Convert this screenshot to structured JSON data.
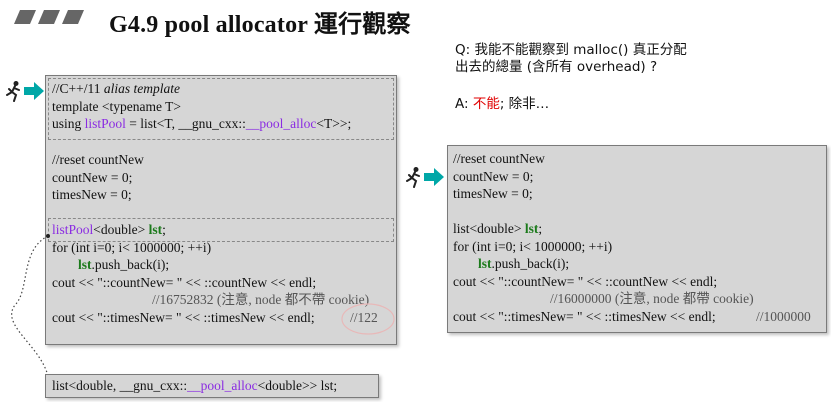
{
  "header": {
    "title": "G4.9 pool allocator 運行觀察"
  },
  "qa": {
    "question_line1": "Q: 我能不能觀察到 malloc() 真正分配",
    "question_line2": "出去的總量 (含所有 overhead) ?",
    "answer_prefix": "A: ",
    "answer_red": "不能",
    "answer_suffix": "; 除非…"
  },
  "left_box": {
    "alias_comment": "//C++/11 ",
    "alias_comment_italic": "alias template",
    "template_line": "template <typename T>",
    "using_prefix": "using ",
    "using_name": "listPool",
    "using_mid": " = list<T, __gnu_cxx::",
    "using_alloc": "__pool_alloc",
    "using_suffix": "<T>>;",
    "reset_comment": "//reset countNew",
    "countNew_line": "countNew = 0;",
    "timesNew_line": "timesNew = 0;",
    "decl_type": "listPool",
    "decl_mid": "<double> ",
    "decl_var": "lst",
    "decl_end": ";",
    "for_line": "for (int i=0; i< 1000000; ++i)",
    "push_var": "lst",
    "push_rest": ".push_back(i);",
    "cout_count": "cout << \"::countNew= \" << ::countNew << endl;",
    "result_count": "//16752832 (注意, node 都不帶 cookie)",
    "cout_times": "cout << \"::timesNew= \" << ::timesNew << endl;",
    "result_times": "//122"
  },
  "bottom_box": {
    "prefix": "list<double, __gnu_cxx::",
    "alloc": "__pool_alloc",
    "suffix": "<double>> lst;"
  },
  "right_box": {
    "reset_comment": "//reset countNew",
    "countNew_line": "countNew = 0;",
    "timesNew_line": "timesNew = 0;",
    "decl_prefix": "list<double> ",
    "decl_var": "lst",
    "decl_end": ";",
    "for_line": "for (int i=0; i< 1000000; ++i)",
    "push_var": "lst",
    "push_rest": ".push_back(i);",
    "cout_count": "cout << \"::countNew= \" << ::countNew << endl;",
    "result_count": "//16000000 (注意, node 都帶 cookie)",
    "cout_times": "cout << \"::timesNew= \" << ::timesNew << endl;",
    "result_times": "//1000000"
  },
  "colors": {
    "accent_arrow": "#00a7a7",
    "purple": "#8a2be2",
    "green": "#1b7a1b",
    "red": "#e00000",
    "box_bg": "#d6d6d6"
  },
  "icons": [
    "parallelogram-bars-icon",
    "runner-icon",
    "right-arrow-icon"
  ]
}
